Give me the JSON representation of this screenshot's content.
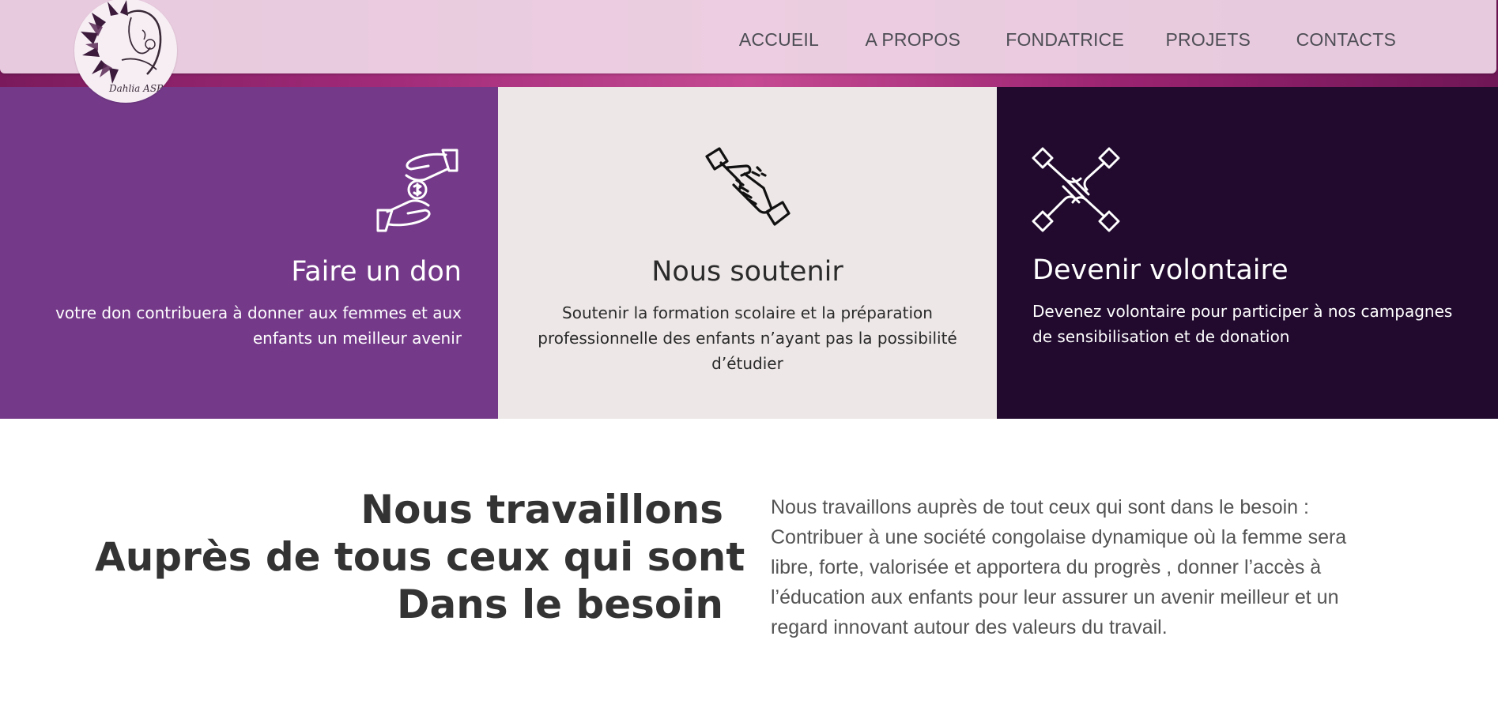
{
  "colors": {
    "header_bg": "#eed6e6",
    "card_don_bg": "#743a89",
    "card_soutenir_bg": "#ede7e7",
    "card_volontaire_bg": "#210a2e",
    "heading_text": "#333333"
  },
  "logo": {
    "text": "Dahlia ASBL",
    "icon": "dahlia-flower-woman-logo"
  },
  "nav": {
    "items": [
      {
        "label": "ACCUEIL"
      },
      {
        "label": "A PROPOS"
      },
      {
        "label": "FONDATRICE"
      },
      {
        "label": "PROJETS"
      },
      {
        "label": "CONTACTS"
      }
    ]
  },
  "cards": [
    {
      "icon": "hands-donation-icon",
      "title": "Faire un don",
      "lines": [
        "votre don contribuera à donner aux femmes et aux",
        "enfants un meilleur avenir"
      ]
    },
    {
      "icon": "handshake-icon",
      "title": "Nous soutenir",
      "lines": [
        "Soutenir la formation scolaire et la préparation",
        "professionnelle des enfants n’ayant pas la possibilité",
        "d’étudier"
      ]
    },
    {
      "icon": "joined-hands-icon",
      "title": "Devenir volontaire",
      "lines": [
        "Devenez volontaire pour participer à nos campagnes",
        "de sensibilisation et de donation"
      ]
    }
  ],
  "about": {
    "heading_lines": [
      "Nous travaillons",
      "Auprès de tous ceux qui sont",
      "Dans le besoin"
    ],
    "paragraph_lines": [
      "Nous travaillons auprès de tout ceux qui sont dans le besoin :",
      "Contribuer à une société congolaise dynamique où la femme sera",
      "libre, forte, valorisée et apportera du progrès , donner l’accès à",
      "l’éducation aux enfants pour leur assurer un avenir meilleur et un",
      "regard innovant autour des valeurs du travail."
    ]
  }
}
